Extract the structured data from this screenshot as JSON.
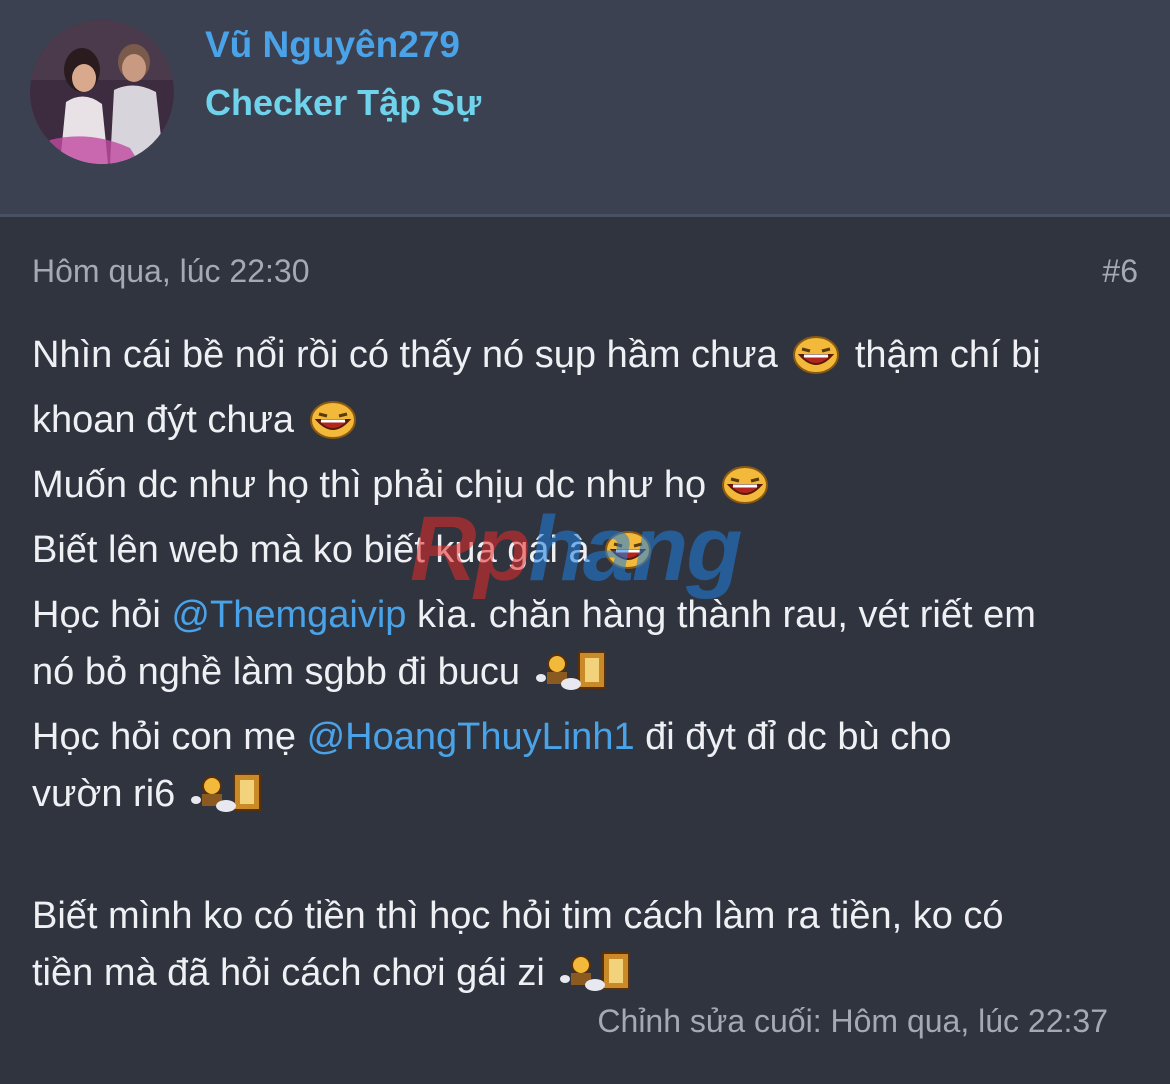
{
  "user": {
    "name": "Vũ Nguyên279",
    "title": "Checker Tập Sự"
  },
  "post": {
    "date": "Hôm qua, lúc 22:30",
    "number": "#6",
    "lines": {
      "l1a": "Nhìn cái bề nổi rồi có thấy nó sụp hầm chưa",
      "l1b": "thậm chí bị",
      "l2": "khoan đýt chưa",
      "l3": "Muốn dc như họ thì phải chịu dc như họ",
      "l4": "Biết lên web mà ko biết kua gái à",
      "l5a": "Học hỏi",
      "l5m": "@Themgaivip",
      "l5b": "kìa. chăn hàng thành rau, vét riết em",
      "l6": "nó bỏ nghề làm sgbb đi bucu",
      "l7a": "Học hỏi con mẹ",
      "l7m": "@HoangThuyLinh1",
      "l7b": "đi đyt đỉ dc bù cho",
      "l8": "vườn ri6",
      "l9": "Biết mình ko có tiền thì học hỏi tim cách làm ra tiền, ko có",
      "l10": "tiền mà đã hỏi cách chơi gái zi"
    },
    "edited": "Chỉnh sửa cuối: Hôm qua, lúc 22:37"
  },
  "watermark": {
    "part1": "Rp",
    "part2": "hang"
  },
  "icons": {
    "laugh": "laughing-emoji-icon",
    "flee": "running-away-emoji-icon"
  }
}
